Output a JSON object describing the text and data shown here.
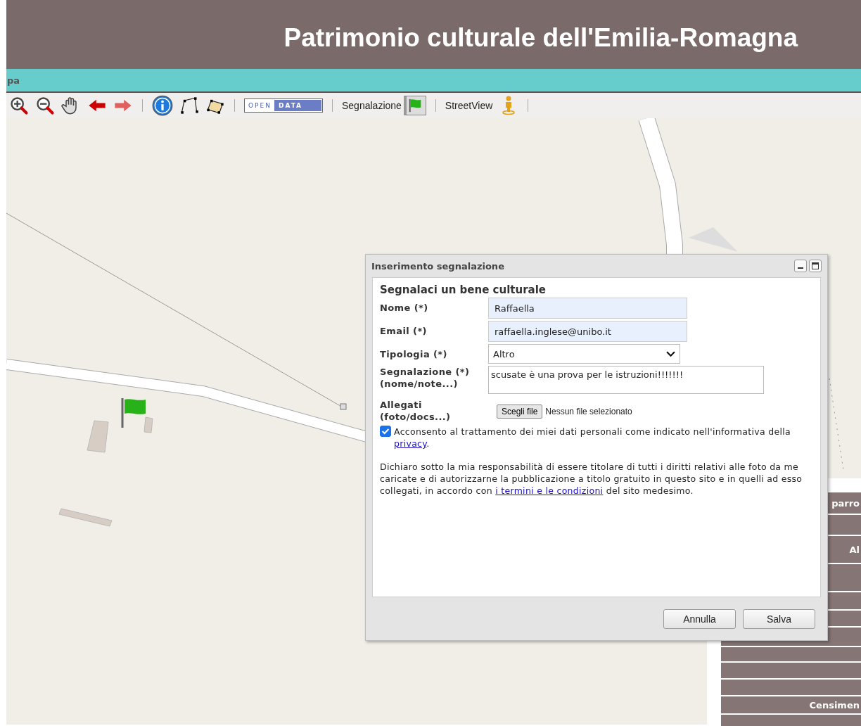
{
  "header": {
    "title": "Patrimonio culturale dell'Emilia-Romagna"
  },
  "menu_bar": {
    "label": "pa"
  },
  "toolbar": {
    "open_data": [
      "OPEN",
      "DATA"
    ],
    "report_label": "Segnalazione",
    "report_tool_selected": true,
    "streetview_label": "StreetView"
  },
  "dialog": {
    "title": "Inserimento segnalazione",
    "heading": "Segnalaci un bene culturale",
    "fields": [
      {
        "kind": "text",
        "label": "Nome (*)",
        "value": "Raffaella"
      },
      {
        "kind": "text",
        "label": "Email (*)",
        "value": "raffaella.inglese@unibo.it"
      },
      {
        "kind": "select",
        "label": "Tipologia (*)",
        "value": "Altro"
      },
      {
        "kind": "textarea",
        "label": "Segnalazione (*)",
        "sublabel": "(nome/note...)",
        "value": "scusate è una prova per le istruzioni!!!!!!!"
      },
      {
        "kind": "file",
        "label": "Allegati",
        "sublabel": "(foto/docs...)",
        "button": "Scegli file",
        "status": "Nessun file selezionato"
      }
    ],
    "consent": {
      "checked": true,
      "text": "Acconsento al trattamento dei miei dati personali come indicato nell'informativa della",
      "link": "privacy",
      "after": "."
    },
    "declaration": {
      "text": "Dichiaro sotto la mia responsabilità di essere titolare di tutti i diritti relativi alle foto da me caricate e di autorizzarne la pubblicazione a titolo gratuito in questo sito e in quelli ad esso collegati, in accordo con",
      "link": "i termini e le condizioni",
      "after": "del sito medesimo."
    },
    "buttons": [
      "Annulla",
      "Salva"
    ]
  },
  "side_panel": {
    "rows": [
      {
        "kind": "text",
        "label": "parro"
      },
      {
        "kind": "blank"
      },
      {
        "kind": "text",
        "label": "Al"
      },
      {
        "kind": "blank"
      },
      {
        "kind": "blank"
      },
      {
        "kind": "blank"
      },
      {
        "kind": "blank"
      },
      {
        "kind": "blank"
      },
      {
        "kind": "blank"
      },
      {
        "kind": "blank"
      },
      {
        "kind": "text",
        "label": "Censimen"
      },
      {
        "kind": "blank"
      }
    ]
  }
}
